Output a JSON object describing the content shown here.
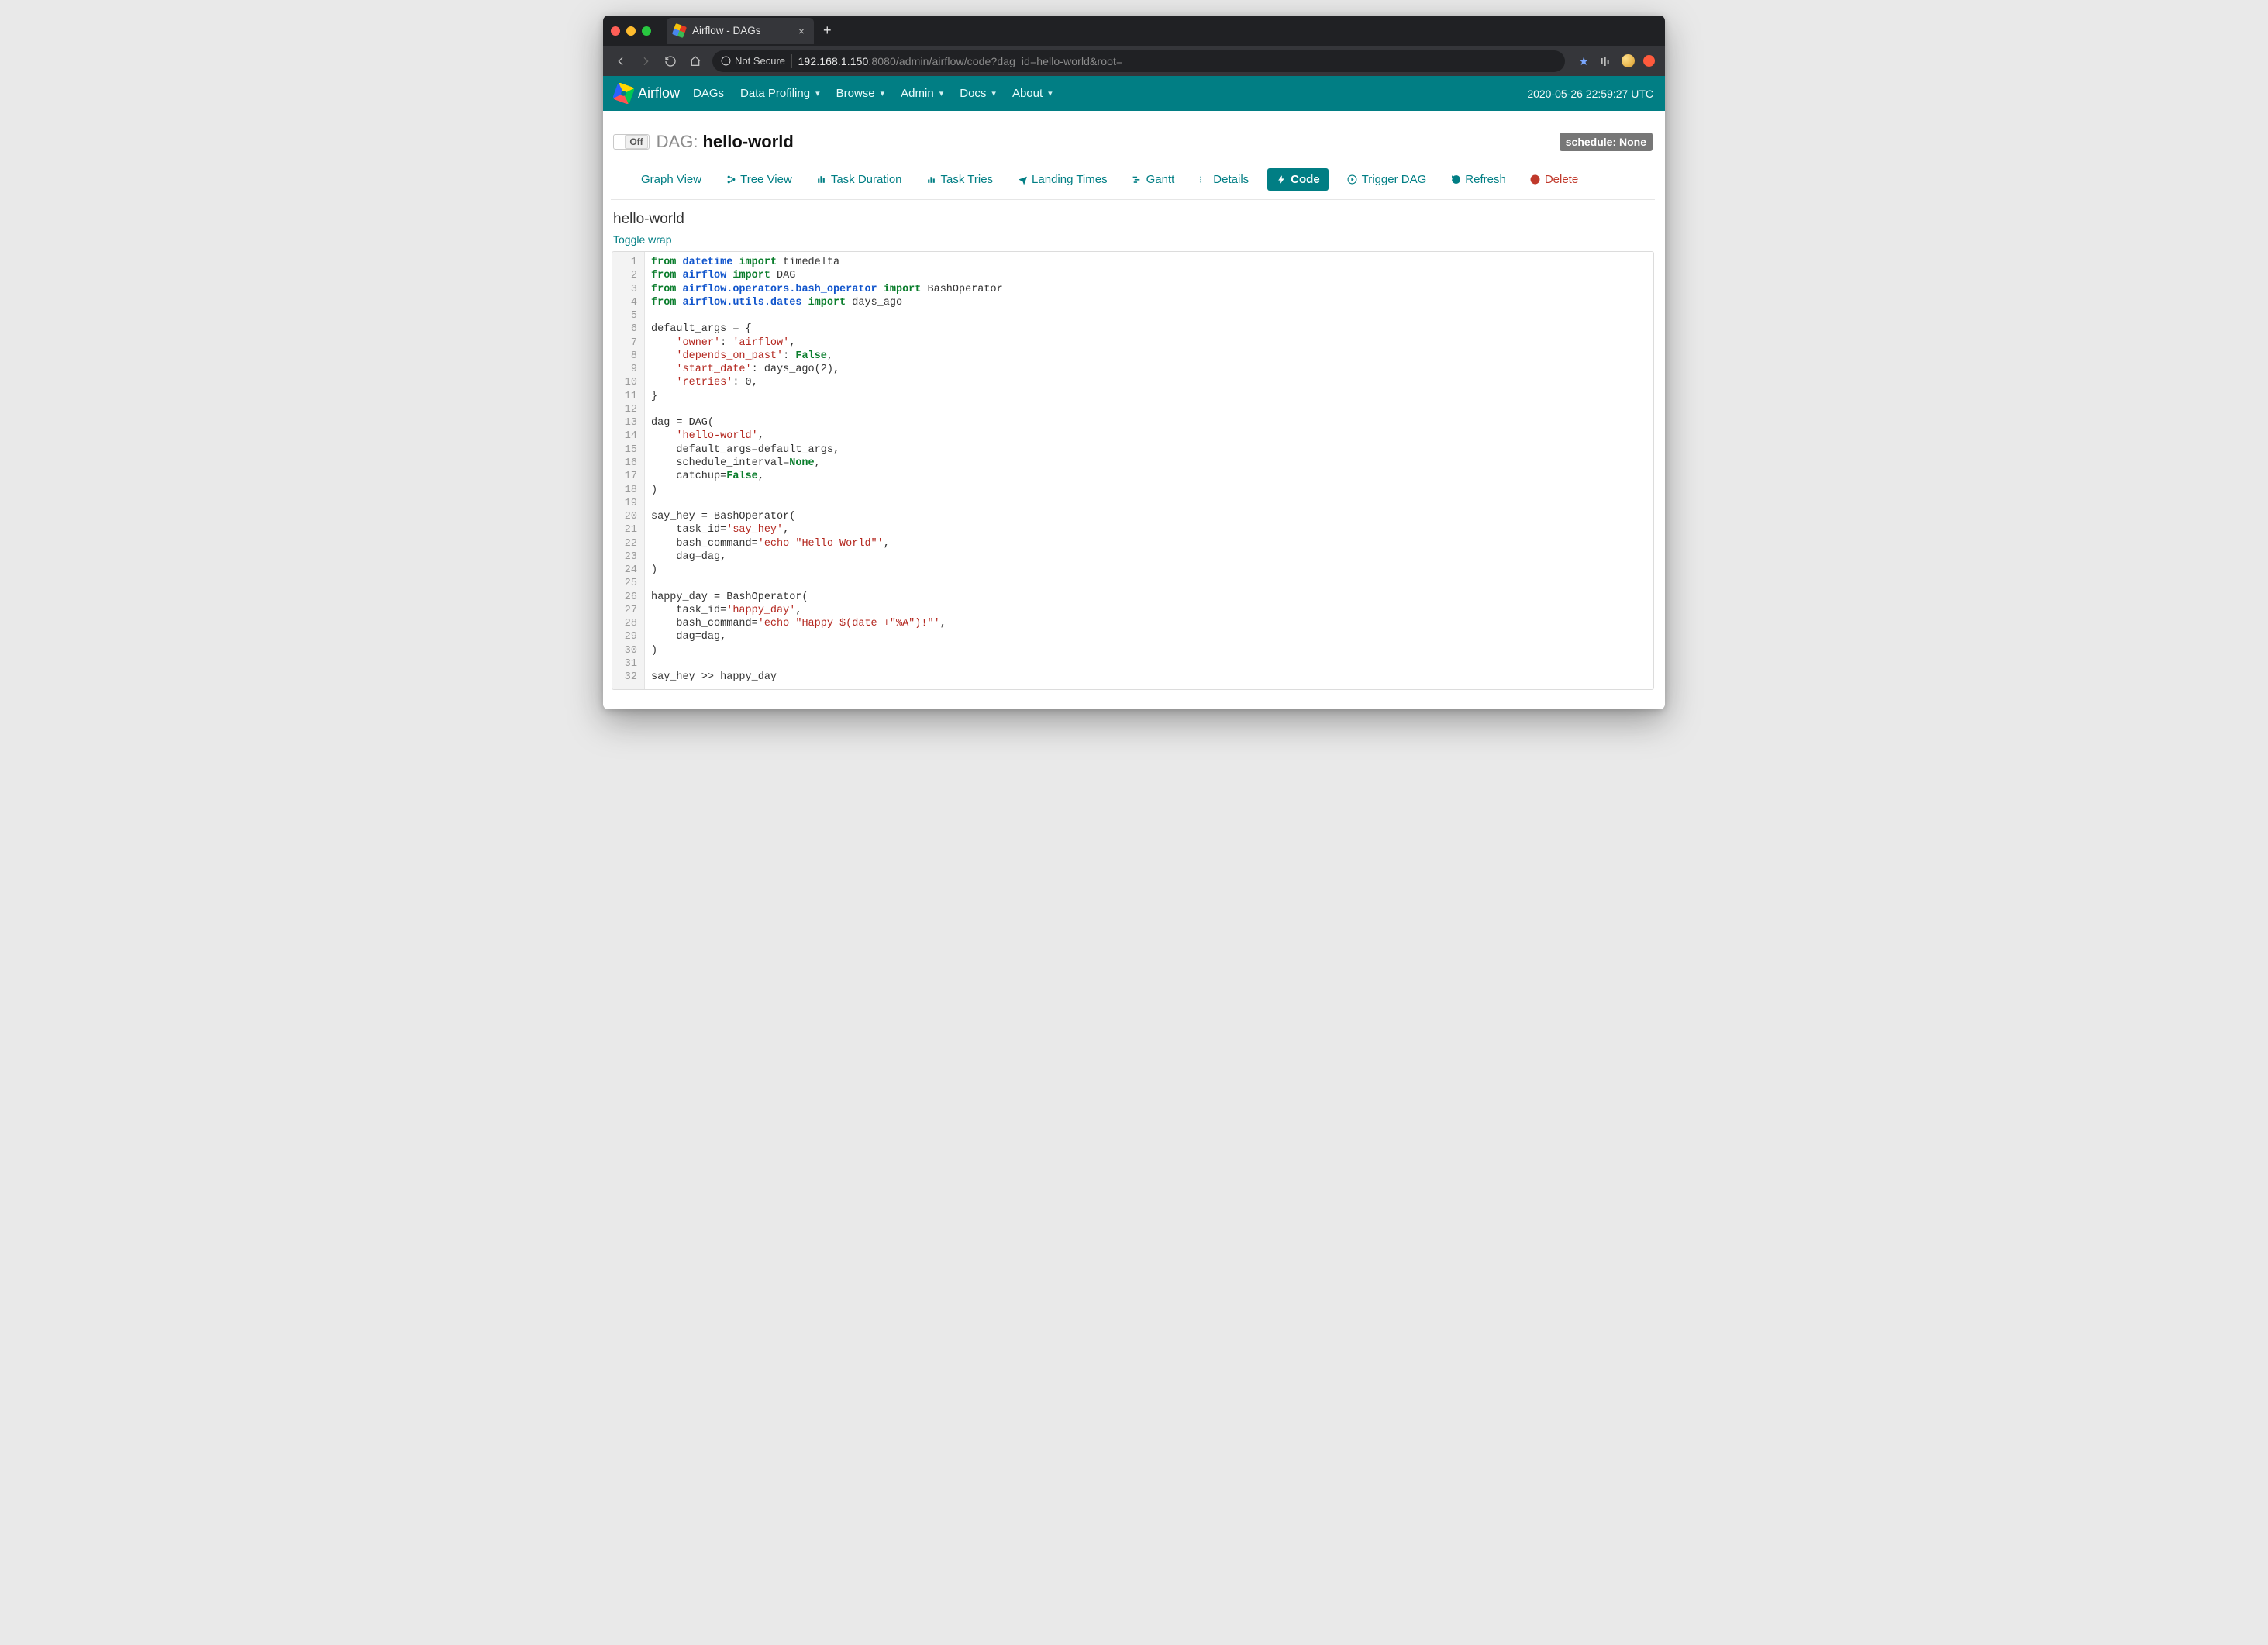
{
  "browser": {
    "tab_title": "Airflow - DAGs",
    "security_label": "Not Secure",
    "url_host": "192.168.1.150",
    "url_port_path": ":8080/admin/airflow/code?dag_id=hello-world&root="
  },
  "navbar": {
    "brand": "Airflow",
    "items": [
      "DAGs",
      "Data Profiling",
      "Browse",
      "Admin",
      "Docs",
      "About"
    ],
    "has_caret": [
      false,
      true,
      true,
      true,
      true,
      true
    ],
    "clock": "2020-05-26 22:59:27 UTC"
  },
  "header": {
    "toggle_off": "Off",
    "label": "DAG:",
    "dag_name": "hello-world",
    "schedule_badge": "schedule: None"
  },
  "tabs": [
    {
      "label": "Graph View",
      "icon": "asterisk-icon"
    },
    {
      "label": "Tree View",
      "icon": "tree-icon"
    },
    {
      "label": "Task Duration",
      "icon": "bar-chart-icon"
    },
    {
      "label": "Task Tries",
      "icon": "retry-chart-icon"
    },
    {
      "label": "Landing Times",
      "icon": "plane-icon"
    },
    {
      "label": "Gantt",
      "icon": "gantt-icon"
    },
    {
      "label": "Details",
      "icon": "list-icon"
    },
    {
      "label": "Code",
      "icon": "bolt-icon",
      "active": true
    },
    {
      "label": "Trigger DAG",
      "icon": "play-circle-icon"
    },
    {
      "label": "Refresh",
      "icon": "refresh-icon"
    },
    {
      "label": "Delete",
      "icon": "trash-icon",
      "danger": true
    }
  ],
  "section": {
    "title": "hello-world",
    "toggle_wrap": "Toggle wrap"
  },
  "code": {
    "line_count": 32,
    "raw": "from datetime import timedelta\nfrom airflow import DAG\nfrom airflow.operators.bash_operator import BashOperator\nfrom airflow.utils.dates import days_ago\n\ndefault_args = {\n    'owner': 'airflow',\n    'depends_on_past': False,\n    'start_date': days_ago(2),\n    'retries': 0,\n}\n\ndag = DAG(\n    'hello-world',\n    default_args=default_args,\n    schedule_interval=None,\n    catchup=False,\n)\n\nsay_hey = BashOperator(\n    task_id='say_hey',\n    bash_command='echo \"Hello World\"',\n    dag=dag,\n)\n\nhappy_day = BashOperator(\n    task_id='happy_day',\n    bash_command='echo \"Happy $(date +\"%A\")!\"',\n    dag=dag,\n)\n\nsay_hey >> happy_day"
  }
}
